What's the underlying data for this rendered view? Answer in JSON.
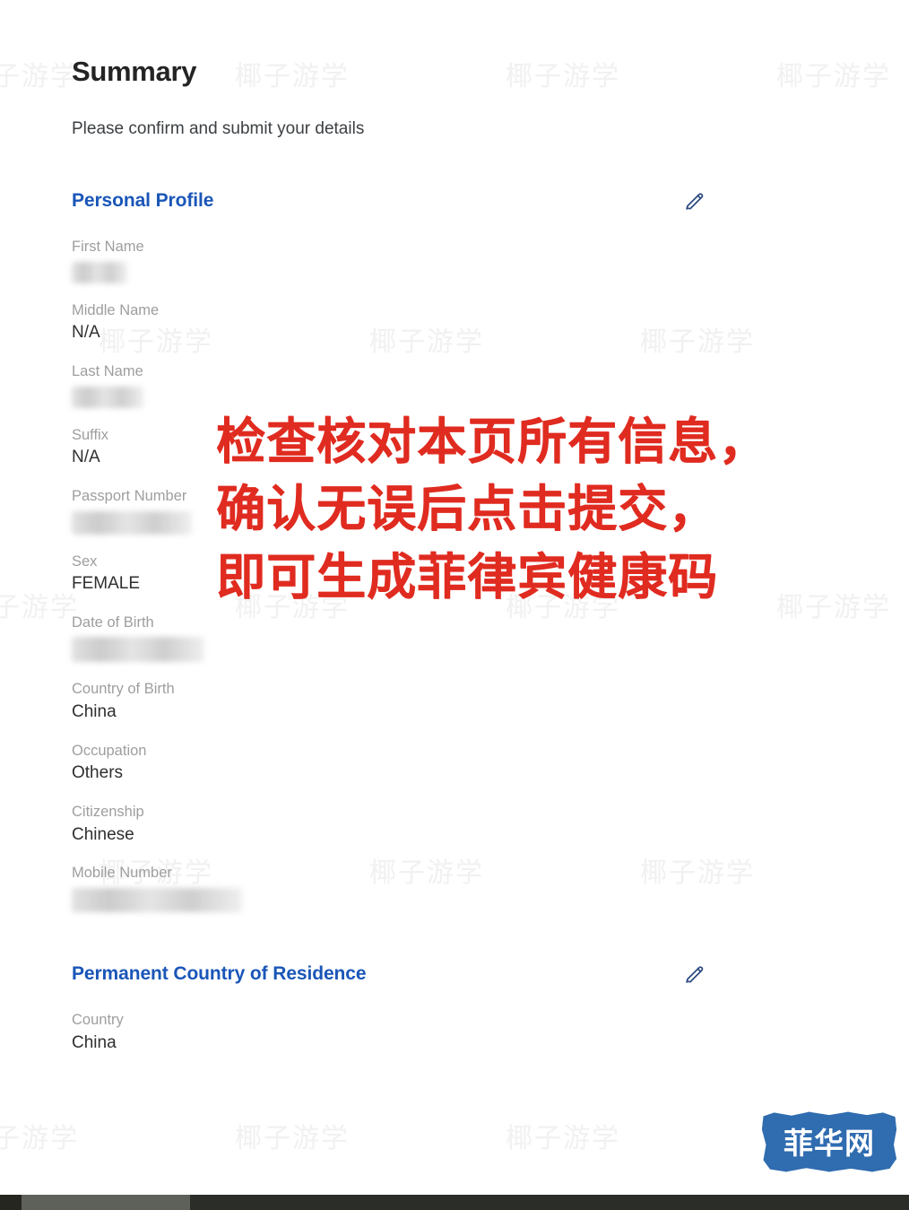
{
  "page": {
    "title": "Summary",
    "subtitle": "Please confirm and submit your details"
  },
  "colors": {
    "section_heading": "#1a56b8",
    "annotation_red": "#e02b20",
    "badge_blue": "#2f6cb0",
    "label_gray": "#9e9e9e",
    "value_dark": "#2f2f2f",
    "watermark_gray": "#f1f1f1",
    "bottom_bar": "#2b2e28"
  },
  "sections": [
    {
      "id": "personal-profile",
      "title": "Personal Profile",
      "edit_icon": "pencil-icon",
      "fields": [
        {
          "label": "First Name",
          "value": "",
          "redacted": true,
          "redact_width": 62,
          "redact_height": 24
        },
        {
          "label": "Middle Name",
          "value": "N/A",
          "redacted": false
        },
        {
          "label": "Last Name",
          "value": "",
          "redacted": true,
          "redact_width": 80,
          "redact_height": 24
        },
        {
          "label": "Suffix",
          "value": "N/A",
          "redacted": false
        },
        {
          "label": "Passport Number",
          "value": "",
          "redacted": true,
          "redact_width": 134,
          "redact_height": 26
        },
        {
          "label": "Sex",
          "value": "FEMALE",
          "redacted": false
        },
        {
          "label": "Date of Birth",
          "value": "",
          "redacted": true,
          "redact_width": 148,
          "redact_height": 28
        },
        {
          "label": "Country of Birth",
          "value": "China",
          "redacted": false
        },
        {
          "label": "Occupation",
          "value": "Others",
          "redacted": false
        },
        {
          "label": "Citizenship",
          "value": "Chinese",
          "redacted": false
        },
        {
          "label": "Mobile Number",
          "value": "",
          "redacted": true,
          "redact_width": 190,
          "redact_height": 27
        }
      ]
    },
    {
      "id": "permanent-country-of-residence",
      "title": "Permanent Country of Residence",
      "edit_icon": "pencil-icon",
      "fields": [
        {
          "label": "Country",
          "value": "China",
          "redacted": false
        }
      ]
    }
  ],
  "annotation": {
    "lines": [
      "检查核对本页所有信息，",
      "确认无误后点击提交，",
      "即可生成菲律宾健康码"
    ]
  },
  "brand_badge": {
    "text": "菲华网"
  },
  "watermark": {
    "text": "椰子游学"
  }
}
